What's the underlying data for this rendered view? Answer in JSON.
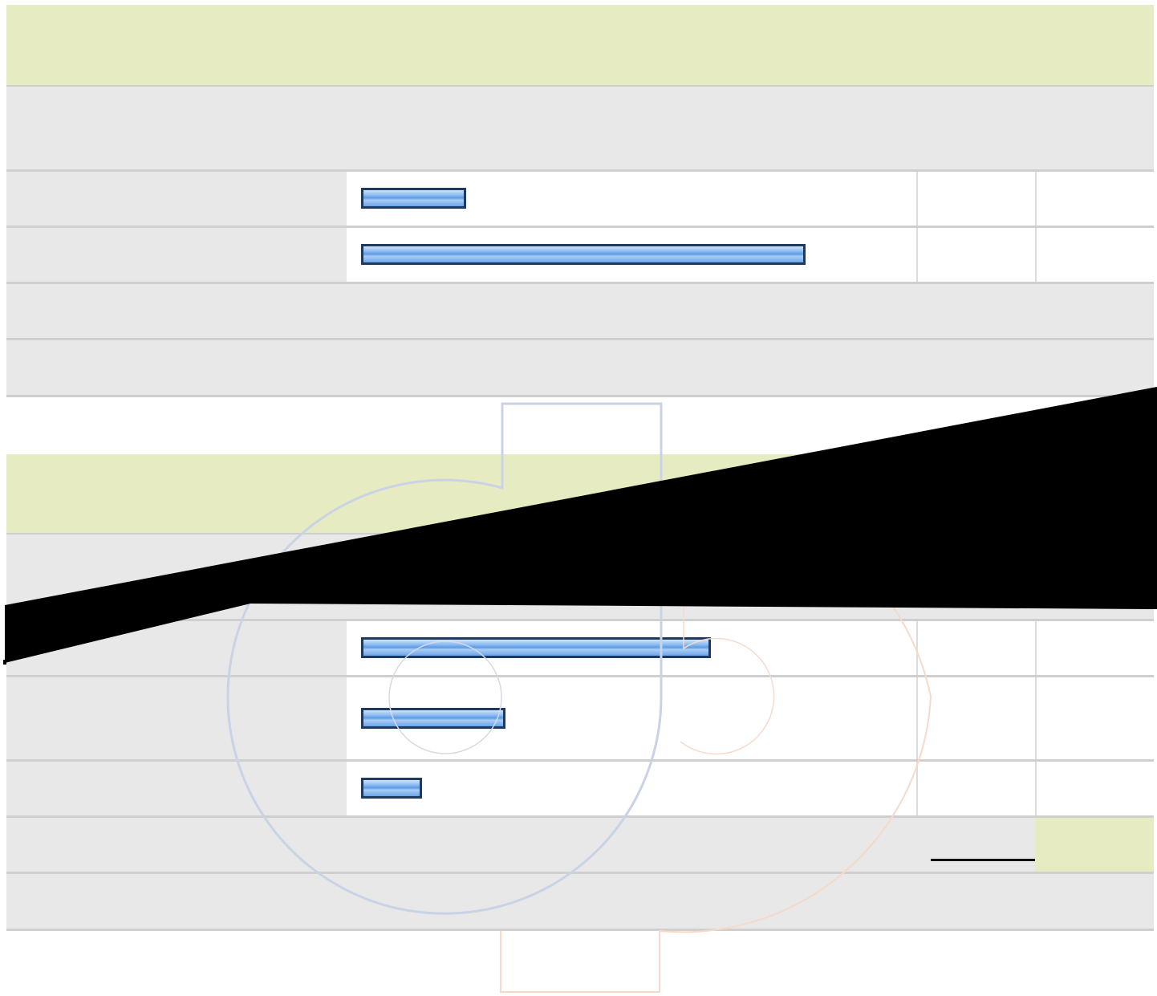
{
  "colors": {
    "header_band": "#e6ebc1",
    "row_grey": "#e8e8e8",
    "divider": "#cfcfcf",
    "bar_border": "#1f3a5f",
    "bar_fill": "#5b9be8",
    "redaction": "#000000"
  },
  "icons": [
    "stamp-watermark-icon"
  ],
  "section_1": {
    "title": "",
    "subtitle": "",
    "rows": [
      {
        "label": "",
        "bar_fraction": 0.19,
        "value_1": "",
        "value_2": ""
      },
      {
        "label": "",
        "bar_fraction": 0.8,
        "value_1": "",
        "value_2": ""
      }
    ],
    "footer_rows": [
      {
        "text": ""
      },
      {
        "text": ""
      }
    ]
  },
  "section_2": {
    "title": "",
    "subtitle": "",
    "rows": [
      {
        "label": "",
        "bar_fraction": 0.63,
        "value_1": "",
        "value_2": ""
      },
      {
        "label": "",
        "bar_fraction": 0.26,
        "value_1": "",
        "value_2": ""
      },
      {
        "label": "",
        "bar_fraction": 0.11,
        "value_1": "",
        "value_2": ""
      }
    ],
    "footer_rows": [
      {
        "text": "",
        "highlight_value": ""
      },
      {
        "text": ""
      }
    ]
  }
}
